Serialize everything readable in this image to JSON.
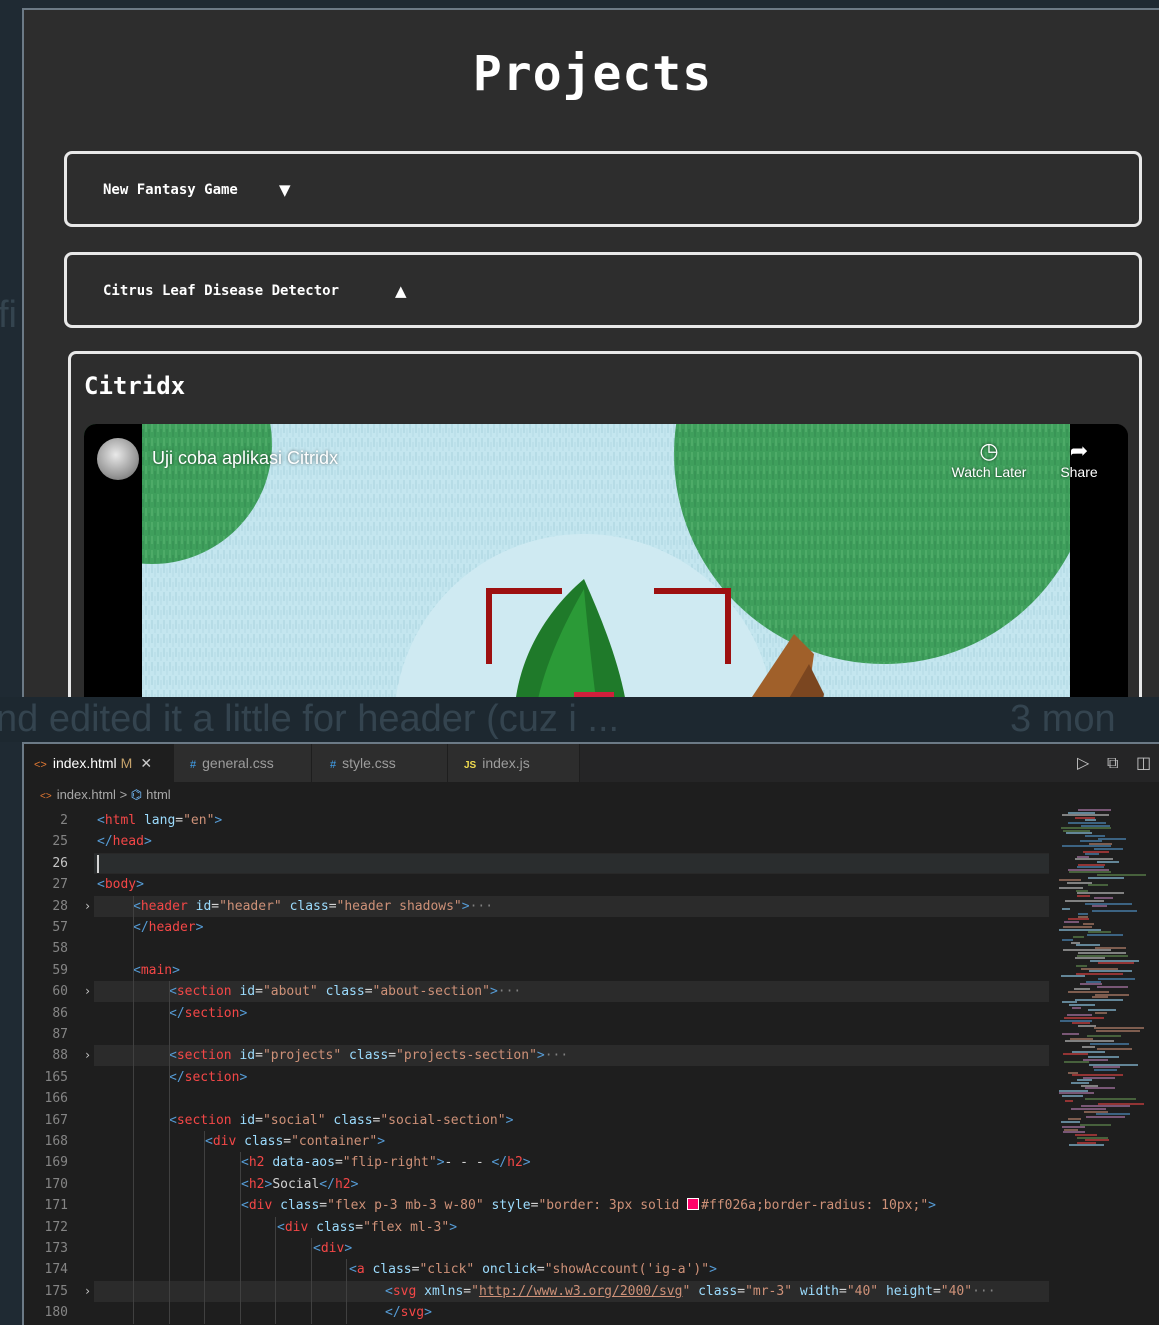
{
  "site": {
    "title": "Projects",
    "accordions": [
      {
        "label": "New Fantasy Game",
        "indicator": "▼",
        "expanded": false
      },
      {
        "label": "Citrus Leaf Disease Detector",
        "indicator": "▲",
        "expanded": true
      }
    ],
    "panel_title": "Citridx",
    "video": {
      "title": "Uji coba aplikasi Citridx",
      "watch_later": "Watch Later",
      "share": "Share"
    }
  },
  "overlay_text": {
    "left": "nd edited it a little for header (cuz i ...",
    "right": "3 mon",
    "edge": "fi"
  },
  "editor": {
    "tabs": [
      {
        "icon": "html-icon",
        "glyph": "<>",
        "label": "index.html",
        "modified": "M",
        "active": true
      },
      {
        "icon": "css-icon",
        "glyph": "#",
        "label": "general.css",
        "active": false
      },
      {
        "icon": "css-icon",
        "glyph": "#",
        "label": "style.css",
        "active": false
      },
      {
        "icon": "js-icon",
        "glyph": "JS",
        "label": "index.js",
        "active": false
      }
    ],
    "breadcrumb": {
      "file": "index.html",
      "separator": ">",
      "node": "html"
    },
    "lines": [
      {
        "num": "2",
        "text": "<html lang=\"en\">"
      },
      {
        "num": "25",
        "text": "</head>"
      },
      {
        "num": "26",
        "text": ""
      },
      {
        "num": "27",
        "text": "<body>"
      },
      {
        "num": "28",
        "text": "<header id=\"header\" class=\"header shadows\">···"
      },
      {
        "num": "57",
        "text": "</header>"
      },
      {
        "num": "58",
        "text": ""
      },
      {
        "num": "59",
        "text": "<main>"
      },
      {
        "num": "60",
        "text": "<section id=\"about\" class=\"about-section\">···"
      },
      {
        "num": "86",
        "text": "</section>"
      },
      {
        "num": "87",
        "text": ""
      },
      {
        "num": "88",
        "text": "<section id=\"projects\" class=\"projects-section\">···"
      },
      {
        "num": "165",
        "text": "</section>"
      },
      {
        "num": "166",
        "text": ""
      },
      {
        "num": "167",
        "text": "<section id=\"social\" class=\"social-section\">"
      },
      {
        "num": "168",
        "text": "<div class=\"container\">"
      },
      {
        "num": "169",
        "text": "<h2 data-aos=\"flip-right\">- - - </h2>"
      },
      {
        "num": "170",
        "text": "<h2>Social</h2>"
      },
      {
        "num": "171",
        "text": "<div class=\"flex p-3 mb-3 w-80\" style=\"border: 3px solid #ff026a;border-radius: 10px;\">"
      },
      {
        "num": "172",
        "text": "<div class=\"flex ml-3\">"
      },
      {
        "num": "173",
        "text": "<div>"
      },
      {
        "num": "174",
        "text": "<a class=\"click\" onclick=\"showAccount('ig-a')\">"
      },
      {
        "num": "175",
        "text": "<svg xmlns=\"http://www.w3.org/2000/svg\" class=\"mr-3\" width=\"40\" height=\"40\"···"
      },
      {
        "num": "180",
        "text": "</svg>"
      }
    ]
  },
  "colors": {
    "swatch": "#ff026a",
    "tag": "#569cd6",
    "tag_name": "#f44747",
    "attribute": "#9cdcfe",
    "string": "#ce9178"
  }
}
